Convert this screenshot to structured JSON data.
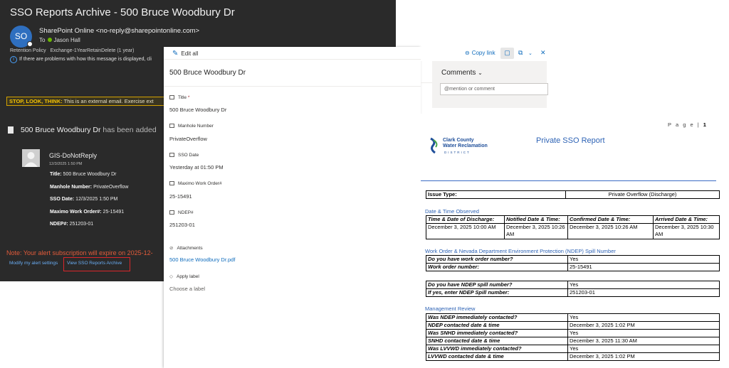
{
  "email": {
    "subject": "SSO Reports Archive - 500 Bruce Woodbury Dr",
    "avatar_initials": "SO",
    "sender": "SharePoint Online <no-reply@sharepointonline.com>",
    "to_label": "To",
    "to_name": "Jason Hall",
    "retention_label": "Retention Policy",
    "retention_value": "Exchange-1YearRetainDelete (1 year)",
    "info_text": "If there are problems with how this message is displayed, cli",
    "warning_bold": "STOP, LOOK, THINK:",
    "warning_text": " This is an external email. Exercise ext",
    "item_added_title": "500 Bruce Woodbury Dr",
    "item_added_suffix": " has been added",
    "author": "GIS-DoNotReply",
    "author_date": "12/3/2025 1:50 PM",
    "fields": [
      {
        "label": "Title:",
        "value": " 500 Bruce Woodbury Dr"
      },
      {
        "label": "Manhole Number:",
        "value": " PrivateOverflow"
      },
      {
        "label": "SSO Date:",
        "value": " 12/3/2025 1:50 PM"
      },
      {
        "label": "Maximo Work Order#:",
        "value": " 25-15491"
      },
      {
        "label": "NDEP#:",
        "value": " 251203-01"
      }
    ],
    "note": "Note: Your alert subscription will expire on 2025-12-",
    "link_modify": "Modify my alert settings",
    "link_view": "View SSO Reports Archive"
  },
  "panel": {
    "edit_all": "Edit all",
    "title": "500 Bruce Woodbury Dr",
    "fields": [
      {
        "label": "Title",
        "required": "*",
        "value": "500 Bruce Woodbury Dr"
      },
      {
        "label": "Manhole Number",
        "value": "PrivateOverflow"
      },
      {
        "label": "SSO Date",
        "value": "Yesterday at 01:50 PM"
      },
      {
        "label": "Maximo Work Order#",
        "value": "25-15491"
      },
      {
        "label": "NDEP#",
        "value": "251203-01"
      },
      {
        "label": "Attachments",
        "value": "500 Bruce Woodbury Dr.pdf"
      },
      {
        "label": "Apply label",
        "value": "Choose a label"
      }
    ]
  },
  "toolbar": {
    "copy_link": "Copy link",
    "close": "✕"
  },
  "comments": {
    "title": "Comments",
    "placeholder": "@mention or comment"
  },
  "report": {
    "page_label": "P a g e",
    "page_number": "1",
    "logo_line1": "Clark County",
    "logo_line2": "Water Reclamation",
    "logo_line3": "DISTRICT",
    "title": "Private SSO Report",
    "issue_type_label": "Issue Type:",
    "issue_type_value": "Private Overflow (Discharge)",
    "dt_section": "Date & Time Observed",
    "dt_headers": [
      "Time & Date of Discharge:",
      "Notified Date & Time:",
      "Confirmed Date & Time:",
      "Arrived Date & Time:"
    ],
    "dt_values": [
      "December 3, 2025 10:00 AM",
      "December 3, 2025 10:26 AM",
      "December 3, 2025 10:26 AM",
      "December 3, 2025 10:30 AM"
    ],
    "wo_section": "Work Order & Nevada Department Environment Protection (NDEP) Spill Number",
    "wo_rows": [
      {
        "label": "Do you have work order number?",
        "value": "Yes"
      },
      {
        "label": "Work order number:",
        "value": "25-15491"
      }
    ],
    "ndep_rows": [
      {
        "label": "Do you have NDEP spill number?",
        "value": "Yes"
      },
      {
        "label": "If yes, enter NDEP Spill number:",
        "value": "251203-01"
      }
    ],
    "mr_section": "Management Review",
    "mr_rows": [
      {
        "label": "Was NDEP immediately contacted?",
        "value": "Yes"
      },
      {
        "label": "NDEP contacted date & time",
        "value": "December 3, 2025 1:02 PM"
      },
      {
        "label": "Was SNHD immediately contacted?",
        "value": "Yes"
      },
      {
        "label": "SNHD contacted date & time",
        "value": "December 3, 2025 11:30 AM"
      },
      {
        "label": "Was LVVWD immediately contacted?",
        "value": "Yes"
      },
      {
        "label": "LVVWD contacted date & time",
        "value": "December 3, 2025 1:02 PM"
      }
    ]
  }
}
